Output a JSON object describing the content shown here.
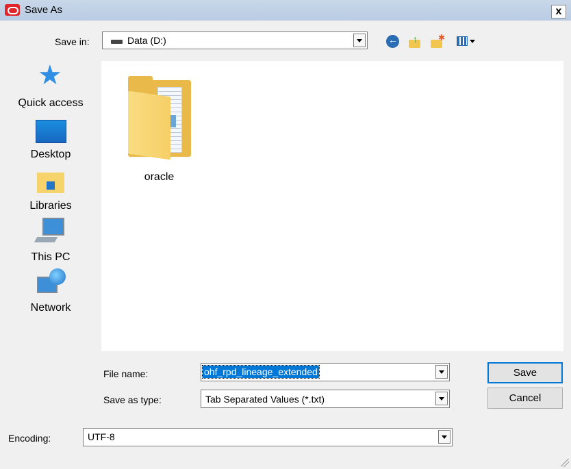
{
  "window": {
    "title": "Save As",
    "close_label": "x"
  },
  "save_in": {
    "label": "Save in:",
    "value": "Data (D:)"
  },
  "toolbar": {
    "back": "back-icon",
    "up": "up-folder-icon",
    "new_folder": "new-folder-icon",
    "views": "view-menu-icon"
  },
  "places": [
    {
      "label": "Quick access",
      "icon": "star-icon"
    },
    {
      "label": "Desktop",
      "icon": "desktop-icon"
    },
    {
      "label": "Libraries",
      "icon": "libraries-icon"
    },
    {
      "label": "This PC",
      "icon": "computer-icon"
    },
    {
      "label": "Network",
      "icon": "network-icon"
    }
  ],
  "files": [
    {
      "name": "oracle",
      "type": "folder"
    }
  ],
  "file_name": {
    "label": "File name:",
    "value": "ohf_rpd_lineage_extended"
  },
  "save_as_type": {
    "label": "Save as type:",
    "value": "Tab Separated Values (*.txt)"
  },
  "encoding": {
    "label": "Encoding:",
    "value": "UTF-8"
  },
  "buttons": {
    "save": "Save",
    "cancel": "Cancel"
  },
  "colors": {
    "selection": "#0078d7",
    "titlebar": "#c3d4e8"
  }
}
